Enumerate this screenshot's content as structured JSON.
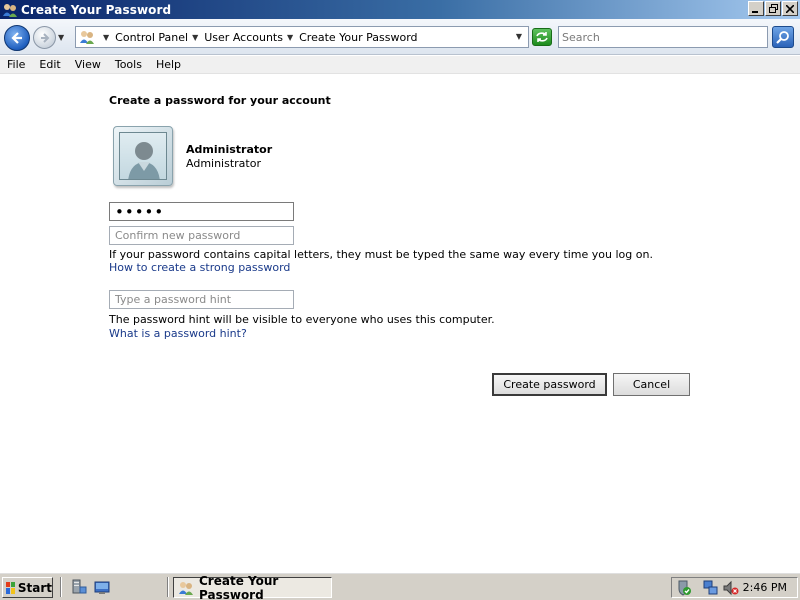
{
  "window": {
    "title": "Create Your Password"
  },
  "navigation": {
    "breadcrumbs": [
      "Control Panel",
      "User Accounts",
      "Create Your Password"
    ],
    "search_placeholder": "Search"
  },
  "menu": [
    "File",
    "Edit",
    "View",
    "Tools",
    "Help"
  ],
  "page": {
    "heading": "Create a password for your account",
    "user": {
      "name": "Administrator",
      "role": "Administrator"
    },
    "new_password_value": "•••••",
    "confirm_placeholder": "Confirm new password",
    "capital_note": "If your password contains capital letters, they must be typed the same way every time you log on.",
    "strong_password_link": "How to create a strong password",
    "hint_placeholder": "Type a password hint",
    "hint_note": "The password hint will be visible to everyone who uses this computer.",
    "hint_link": "What is a password hint?",
    "create_button": "Create password",
    "cancel_button": "Cancel"
  },
  "taskbar": {
    "start_label": "Start",
    "active_task": "Create Your Password",
    "clock": "2:46 PM"
  },
  "icons": {
    "title": "user-accounts-icon",
    "address": "user-accounts-icon",
    "refresh": "refresh-icon",
    "search": "magnifier-icon",
    "tray": [
      "security-shield-icon",
      "network-icon",
      "volume-muted-icon"
    ]
  },
  "colors": {
    "title_bar": "#0a246a",
    "link": "#1a3a8a",
    "taskbar": "#d4d0c8"
  }
}
